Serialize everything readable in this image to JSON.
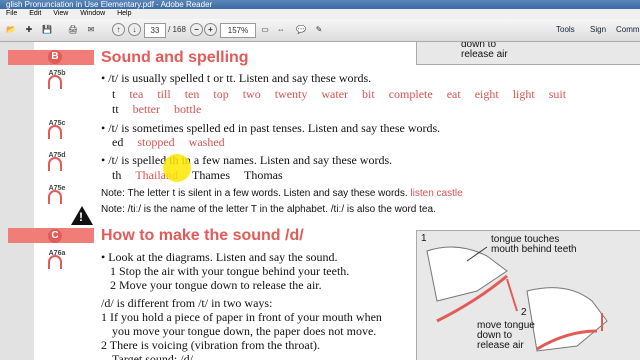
{
  "window": {
    "title": "glish Pronunciation in Use Elementary.pdf - Adobe Reader"
  },
  "menu": [
    "File",
    "Edit",
    "View",
    "Window",
    "Help"
  ],
  "toolbar": {
    "page": "33",
    "total": "/ 168",
    "zoom": "157%",
    "tools": "Tools",
    "sign": "Sign",
    "comment": "Comm"
  },
  "doc": {
    "top_callout": "down to\nrelease air",
    "sectionB": {
      "letter": "B",
      "title": "Sound and spelling",
      "tracks": [
        "A75b",
        "A75c",
        "A75d",
        "A75e"
      ],
      "l1": "/t/ is usually spelled t or tt. Listen and say these words.",
      "w1": [
        "t",
        "tea",
        "till",
        "ten",
        "top",
        "two",
        "twenty",
        "water",
        "bit",
        "complete",
        "eat",
        "eight",
        "light",
        "suit"
      ],
      "w1b": [
        "tt",
        "better",
        "bottle"
      ],
      "l2": "/t/ is sometimes spelled ed in past tenses. Listen and say these words.",
      "w2": [
        "ed",
        "stopped",
        "washed"
      ],
      "l3": "/t/ is spelled th in a few names. Listen and say these words.",
      "w3": [
        "th",
        "Thailand",
        "Thames",
        "Thomas"
      ],
      "note1a": "Note: The letter t is silent in a few words. Listen and say these words.",
      "note1b": "listen   castle",
      "note2": "Note: /tiː/ is the name of the letter T in the alphabet. /tiː/ is also the word tea."
    },
    "sectionC": {
      "letter": "C",
      "title": "How to make the sound /d/",
      "track": "A76a",
      "l1": "Look at the diagrams. Listen and say the sound.",
      "l2": "1 Stop the air with your tongue behind your teeth.",
      "l3": "2 Move your tongue down to release the air.",
      "l4": "/d/ is different from /t/ in two ways:",
      "l5": "1 If you hold a piece of paper in front of your mouth when",
      "l6": "you move your tongue down, the paper does not move.",
      "l7": "2 There is voicing (vibration from the throat).",
      "l8": "Target sound: /d/"
    },
    "diagram": {
      "n1": "1",
      "n2": "2",
      "lab1": "tongue touches\nmouth behind teeth",
      "lab2": "move tongue\ndown to\nrelease air"
    }
  }
}
